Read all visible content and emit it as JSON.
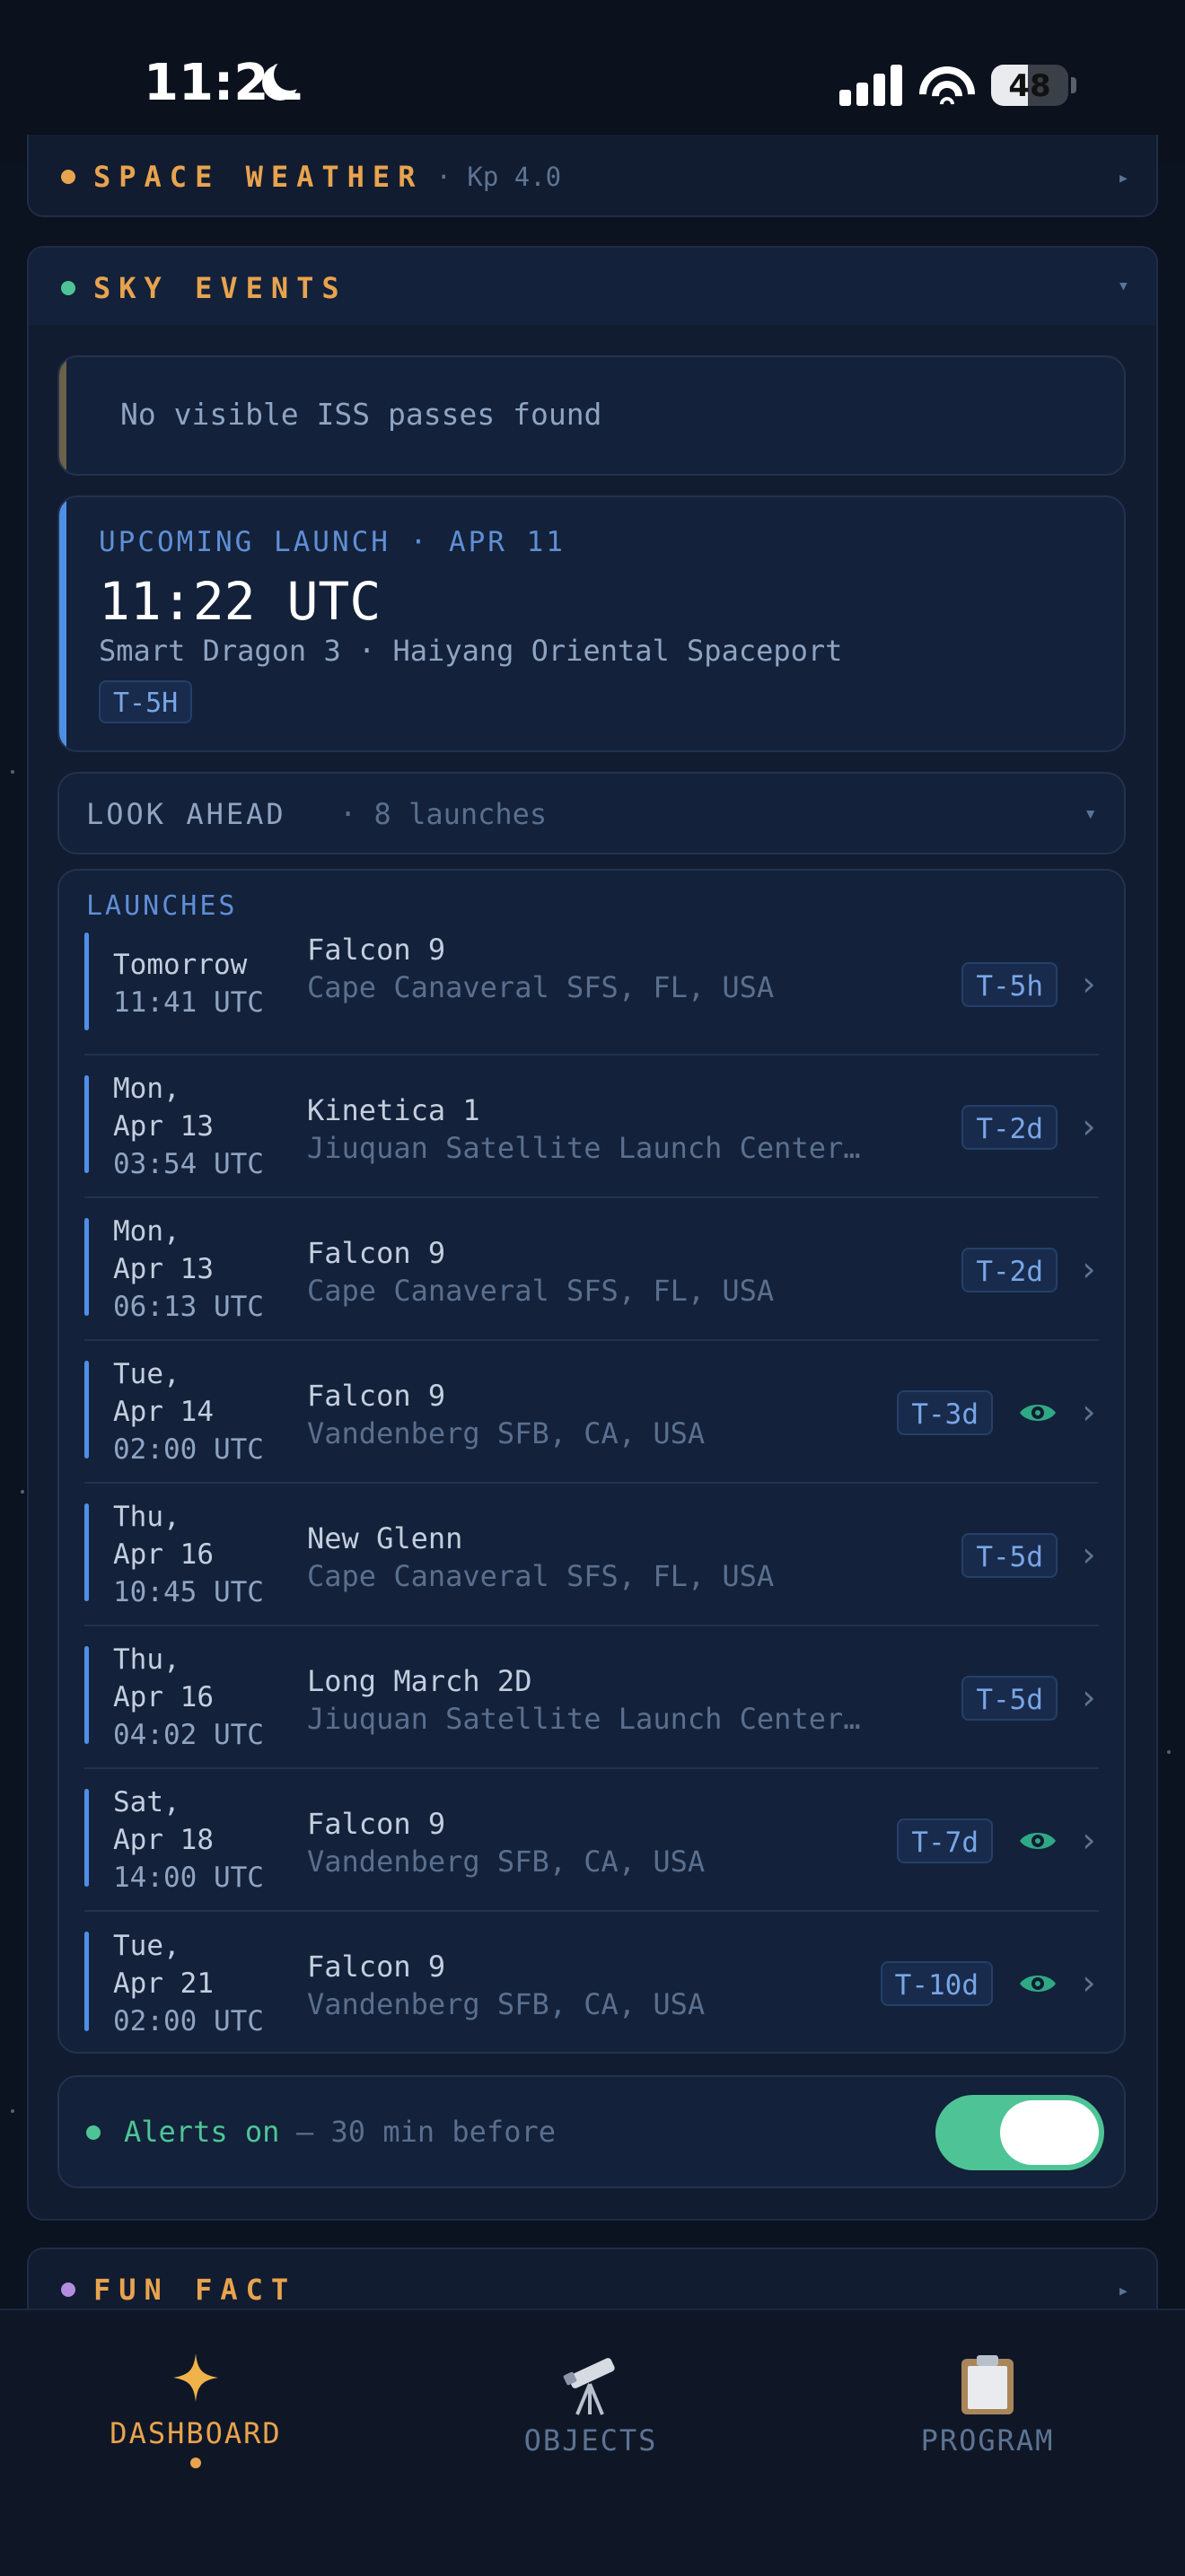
{
  "status_bar": {
    "time": "11:21",
    "battery": "48",
    "battery_level": 0.48
  },
  "space_weather": {
    "title": "SPACE WEATHER",
    "sub": "· Kp 4.0",
    "dot_color": "#e8a34e"
  },
  "sky_events": {
    "title": "SKY EVENTS",
    "dot_color": "#4ec496",
    "iss_message": "No visible ISS passes found",
    "upcoming": {
      "label": "UPCOMING LAUNCH · APR 11",
      "time": "11:22 UTC",
      "detail": "Smart Dragon 3 · Haiyang Oriental Spaceport",
      "badge": "T-5H"
    },
    "look_ahead": {
      "label": "LOOK AHEAD",
      "count": "· 8 launches"
    },
    "launches_header": "LAUNCHES",
    "launches": [
      {
        "day": "Tomorrow",
        "date": "",
        "time": "11:41 UTC",
        "name": "Falcon 9",
        "site": "Cape Canaveral SFS, FL, USA",
        "badge": "T-5h",
        "visible": false
      },
      {
        "day": "Mon,",
        "date": "Apr 13",
        "time": "03:54 UTC",
        "name": "Kinetica 1",
        "site": "Jiuquan Satellite Launch Center…",
        "badge": "T-2d",
        "visible": false
      },
      {
        "day": "Mon,",
        "date": "Apr 13",
        "time": "06:13 UTC",
        "name": "Falcon 9",
        "site": "Cape Canaveral SFS, FL, USA",
        "badge": "T-2d",
        "visible": false
      },
      {
        "day": "Tue,",
        "date": "Apr 14",
        "time": "02:00 UTC",
        "name": "Falcon 9",
        "site": "Vandenberg SFB, CA, USA",
        "badge": "T-3d",
        "visible": true
      },
      {
        "day": "Thu,",
        "date": "Apr 16",
        "time": "10:45 UTC",
        "name": "New Glenn",
        "site": "Cape Canaveral SFS, FL, USA",
        "badge": "T-5d",
        "visible": false
      },
      {
        "day": "Thu,",
        "date": "Apr 16",
        "time": "04:02 UTC",
        "name": "Long March 2D",
        "site": "Jiuquan Satellite Launch Center…",
        "badge": "T-5d",
        "visible": false
      },
      {
        "day": "Sat,",
        "date": "Apr 18",
        "time": "14:00 UTC",
        "name": "Falcon 9",
        "site": "Vandenberg SFB, CA, USA",
        "badge": "T-7d",
        "visible": true
      },
      {
        "day": "Tue,",
        "date": "Apr 21",
        "time": "02:00 UTC",
        "name": "Falcon 9",
        "site": "Vandenberg SFB, CA, USA",
        "badge": "T-10d",
        "visible": true
      }
    ],
    "alerts": {
      "label": "Alerts on",
      "detail": "— 30 min before",
      "enabled": true
    }
  },
  "fun_fact": {
    "title": "FUN FACT",
    "dot_color": "#b48ede"
  },
  "nav": [
    {
      "label": "DASHBOARD",
      "icon": "sparkle-icon",
      "active": true
    },
    {
      "label": "OBJECTS",
      "icon": "telescope-icon",
      "active": false
    },
    {
      "label": "PROGRAM",
      "icon": "clipboard-icon",
      "active": false
    }
  ],
  "colors": {
    "accent": "#e8a34e",
    "launch_blue": "#4f8fe6",
    "green": "#4ec496",
    "background": "#0b1220"
  }
}
